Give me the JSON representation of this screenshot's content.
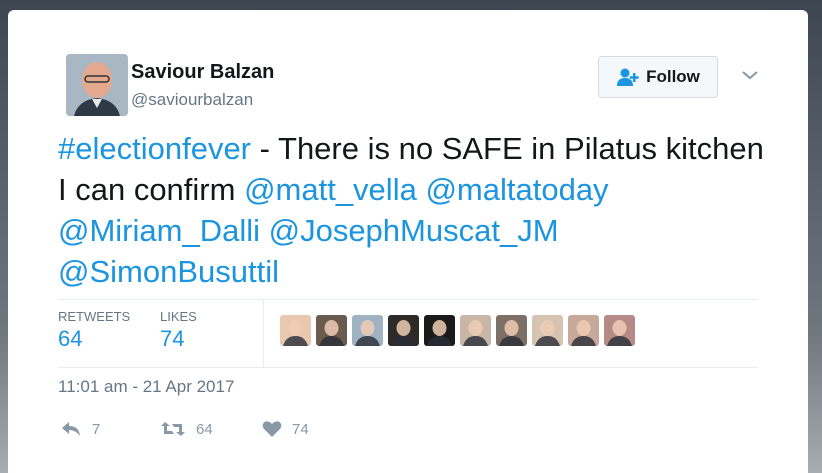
{
  "user": {
    "name": "Saviour Balzan",
    "handle": "@saviourbalzan"
  },
  "follow_button": {
    "label": "Follow"
  },
  "tweet": {
    "parts": [
      {
        "text": "#electionfever",
        "link": true
      },
      {
        "text": " - There is no SAFE in Pilatus kitchen I can confirm ",
        "link": false
      },
      {
        "text": "@matt_vella",
        "link": true
      },
      {
        "text": " ",
        "link": false
      },
      {
        "text": "@maltatoday",
        "link": true
      },
      {
        "text": " ",
        "link": false
      },
      {
        "text": "@Miriam_Dalli",
        "link": true
      },
      {
        "text": " ",
        "link": false
      },
      {
        "text": "@JosephMuscat_JM",
        "link": true
      },
      {
        "text": " ",
        "link": false
      },
      {
        "text": "@SimonBusuttil",
        "link": true
      }
    ]
  },
  "stats": {
    "retweets_label": "RETWEETS",
    "retweets_value": "64",
    "likes_label": "LIKES",
    "likes_value": "74"
  },
  "likers": [
    {
      "name": "liker-1",
      "color": "#e8c9b0"
    },
    {
      "name": "liker-2",
      "color": "#6b5a4e"
    },
    {
      "name": "liker-3",
      "color": "#9fb3c2"
    },
    {
      "name": "liker-4",
      "color": "#2e2a28"
    },
    {
      "name": "liker-5",
      "color": "#1a1a1a"
    },
    {
      "name": "liker-6",
      "color": "#c8b7a8"
    },
    {
      "name": "liker-7",
      "color": "#7d6e66"
    },
    {
      "name": "liker-8",
      "color": "#d6c3b2"
    },
    {
      "name": "liker-9",
      "color": "#c7a89a"
    },
    {
      "name": "liker-10",
      "color": "#b68a86"
    }
  ],
  "timestamp": "11:01 am - 21 Apr 2017",
  "actions": {
    "reply_count": "7",
    "retweet_count": "64",
    "like_count": "74"
  },
  "colors": {
    "link": "#1b95e0",
    "muted": "#657786"
  }
}
